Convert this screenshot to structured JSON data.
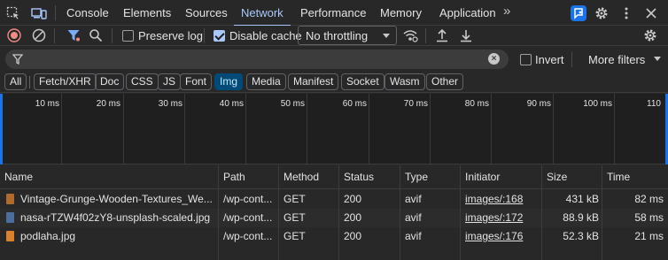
{
  "tabs": [
    {
      "label": "Console"
    },
    {
      "label": "Elements"
    },
    {
      "label": "Sources"
    },
    {
      "label": "Network"
    },
    {
      "label": "Performance"
    },
    {
      "label": "Memory"
    },
    {
      "label": "Application"
    }
  ],
  "active_tab": "Network",
  "more_tabs_glyph": "»",
  "toolbar": {
    "preserve_log_label": "Preserve log",
    "preserve_log_checked": false,
    "disable_cache_label": "Disable cache",
    "disable_cache_checked": true,
    "throttling_value": "No throttling"
  },
  "filter": {
    "value": "",
    "invert_label": "Invert",
    "invert_checked": false,
    "more_filters_label": "More filters"
  },
  "type_filters": [
    {
      "label": "All",
      "active": false
    },
    {
      "label": "Fetch/XHR",
      "active": false
    },
    {
      "label": "Doc",
      "active": false
    },
    {
      "label": "CSS",
      "active": false
    },
    {
      "label": "JS",
      "active": false
    },
    {
      "label": "Font",
      "active": false
    },
    {
      "label": "Img",
      "active": true
    },
    {
      "label": "Media",
      "active": false
    },
    {
      "label": "Manifest",
      "active": false
    },
    {
      "label": "Socket",
      "active": false
    },
    {
      "label": "Wasm",
      "active": false
    },
    {
      "label": "Other",
      "active": false
    }
  ],
  "timeline": {
    "ticks": [
      "10 ms",
      "20 ms",
      "30 ms",
      "40 ms",
      "50 ms",
      "60 ms",
      "70 ms",
      "80 ms",
      "90 ms",
      "100 ms",
      "110"
    ]
  },
  "columns": {
    "name": "Name",
    "path": "Path",
    "method": "Method",
    "status": "Status",
    "type": "Type",
    "initiator": "Initiator",
    "size": "Size",
    "time": "Time"
  },
  "requests": [
    {
      "name": "Vintage-Grunge-Wooden-Textures_We...",
      "path": "/wp-cont...",
      "method": "GET",
      "status": "200",
      "type": "avif",
      "initiator": "images/:168",
      "size": "431 kB",
      "time": "82 ms",
      "icon_color": "#b06a2c"
    },
    {
      "name": "nasa-rTZW4f02zY8-unsplash-scaled.jpg",
      "path": "/wp-cont...",
      "method": "GET",
      "status": "200",
      "type": "avif",
      "initiator": "images/:172",
      "size": "88.9 kB",
      "time": "58 ms",
      "icon_color": "#4a6f9c"
    },
    {
      "name": "podlaha.jpg",
      "path": "/wp-cont...",
      "method": "GET",
      "status": "200",
      "type": "avif",
      "initiator": "images/:176",
      "size": "52.3 kB",
      "time": "21 ms",
      "icon_color": "#d9822b"
    }
  ],
  "colors": {
    "accent": "#a8c7fa",
    "record_red": "#f28b82",
    "filter_active_blue": "#7cacf8"
  }
}
